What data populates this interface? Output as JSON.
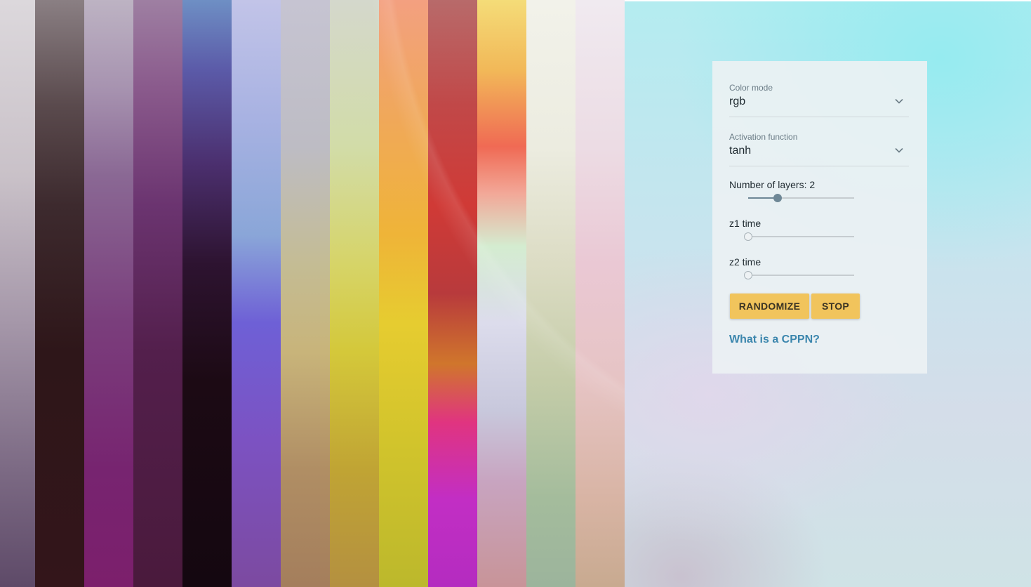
{
  "controls": {
    "color_mode": {
      "label": "Color mode",
      "value": "rgb",
      "icon": "chevron-down-icon"
    },
    "activation": {
      "label": "Activation function",
      "value": "tanh",
      "icon": "chevron-down-icon"
    },
    "layers": {
      "label": "Number of layers: 2",
      "value": 2,
      "level": 0.28
    },
    "z1": {
      "label": "z1 time",
      "level": 0
    },
    "z2": {
      "label": "z2 time",
      "level": 0
    }
  },
  "buttons": {
    "randomize": "RANDOMIZE",
    "stop": "STOP"
  },
  "link": {
    "text": "What is a CPPN?"
  },
  "colors": {
    "button_bg": "#f1c45c",
    "link": "#3b86ad",
    "slider_active": "#6e8796"
  }
}
